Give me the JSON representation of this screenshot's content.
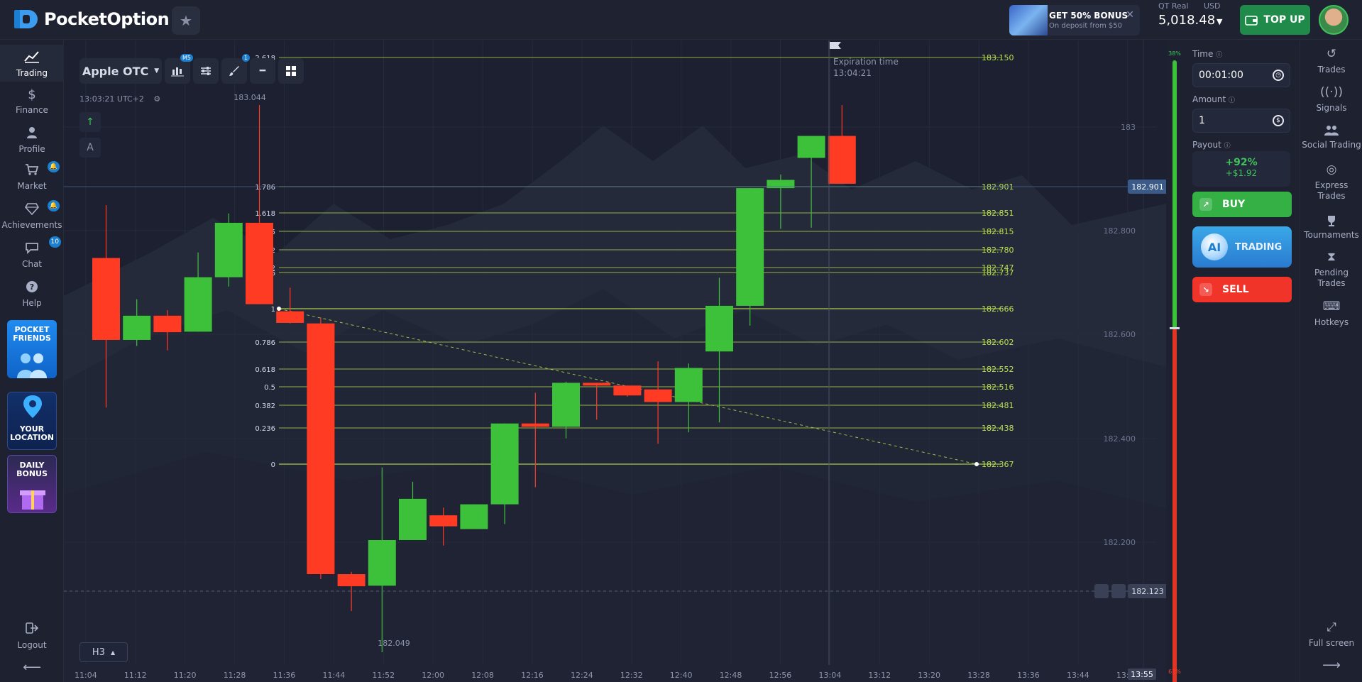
{
  "header": {
    "brand": "PocketOption",
    "bonus_title": "GET 50% BONUS",
    "bonus_sub": "On deposit from $50",
    "account_type": "QT Real",
    "currency": "USD",
    "balance": "5,018.48",
    "topup_label": "TOP UP"
  },
  "left_nav": {
    "items": [
      {
        "label": "Trading",
        "icon": "trading-chart-icon"
      },
      {
        "label": "Finance",
        "icon": "dollar-icon"
      },
      {
        "label": "Profile",
        "icon": "user-icon"
      },
      {
        "label": "Market",
        "icon": "cart-icon"
      },
      {
        "label": "Achievements",
        "icon": "diamond-icon"
      },
      {
        "label": "Chat",
        "icon": "chat-icon"
      },
      {
        "label": "Help",
        "icon": "help-icon"
      }
    ],
    "chat_badge": "10",
    "promos": {
      "friends": "POCKET FRIENDS",
      "location": "YOUR LOCATION",
      "daily": "DAILY BONUS"
    },
    "logout": "Logout"
  },
  "toolbar": {
    "asset": "Apple OTC",
    "indicator_badge": "M5",
    "drawing_badge": "1"
  },
  "chart_info": {
    "clock": "13:03:21 UTC+2",
    "timeframe": "H3",
    "expiration_label": "Expiration time",
    "expiration_time": "13:04:21",
    "high_label": "183.044",
    "low_label": "182.049"
  },
  "trade_panel": {
    "time_label": "Time",
    "time_value": "00:01:00",
    "amount_label": "Amount",
    "amount_value": "1",
    "payout_label": "Payout",
    "payout_pct": "+92%",
    "payout_amount": "+$1.92",
    "buy_label": "BUY",
    "ai_label": "TRADING",
    "ai_badge": "AI",
    "sell_label": "SELL",
    "sentiment_up": "38%",
    "sentiment_down": "62%"
  },
  "right_nav": {
    "items": [
      {
        "label": "Trades",
        "icon": "history-icon"
      },
      {
        "label": "Signals",
        "icon": "signal-icon"
      },
      {
        "label": "Social Trading",
        "icon": "people-icon"
      },
      {
        "label": "Express Trades",
        "icon": "target-icon"
      },
      {
        "label": "Tournaments",
        "icon": "trophy-icon"
      },
      {
        "label": "Pending Trades",
        "icon": "hourglass-icon"
      },
      {
        "label": "Hotkeys",
        "icon": "keyboard-icon"
      }
    ],
    "fullscreen": "Full screen"
  },
  "chart_data": {
    "type": "candlestick",
    "x": [
      "11:04",
      "11:12",
      "11:20",
      "11:28",
      "11:36",
      "11:44",
      "11:52",
      "12:00",
      "12:08",
      "12:16",
      "12:24",
      "12:32",
      "12:40",
      "12:48",
      "12:56",
      "13:04",
      "13:12",
      "13:20",
      "13:28",
      "13:36",
      "13:44",
      "13:5"
    ],
    "y_ticks": [
      "183",
      "182.800",
      "182.600",
      "182.400",
      "182.200"
    ],
    "current_price": "182.901",
    "alert_price": "182.123",
    "time_cursor": "13:55",
    "candles": [
      {
        "o": 182.766,
        "h": 182.862,
        "l": 182.494,
        "c": 182.617
      },
      {
        "o": 182.617,
        "h": 182.691,
        "l": 182.606,
        "c": 182.661
      },
      {
        "o": 182.661,
        "h": 182.671,
        "l": 182.598,
        "c": 182.631
      },
      {
        "o": 182.632,
        "h": 182.776,
        "l": 182.633,
        "c": 182.731
      },
      {
        "o": 182.731,
        "h": 182.847,
        "l": 182.714,
        "c": 182.83
      },
      {
        "o": 182.83,
        "h": 183.044,
        "l": 182.689,
        "c": 182.682
      },
      {
        "o": 182.669,
        "h": 182.712,
        "l": 182.647,
        "c": 182.648
      },
      {
        "o": 182.647,
        "h": 182.658,
        "l": 182.182,
        "c": 182.191
      },
      {
        "o": 182.191,
        "h": 182.195,
        "l": 182.124,
        "c": 182.169
      },
      {
        "o": 182.17,
        "h": 182.385,
        "l": 182.049,
        "c": 182.253
      },
      {
        "o": 182.253,
        "h": 182.359,
        "l": 182.315,
        "c": 182.328
      },
      {
        "o": 182.298,
        "h": 182.312,
        "l": 182.243,
        "c": 182.278
      },
      {
        "o": 182.273,
        "h": 182.297,
        "l": 182.289,
        "c": 182.318
      },
      {
        "o": 182.318,
        "h": 182.439,
        "l": 182.282,
        "c": 182.465
      },
      {
        "o": 182.465,
        "h": 182.521,
        "l": 182.349,
        "c": 182.459
      },
      {
        "o": 182.459,
        "h": 182.541,
        "l": 182.438,
        "c": 182.539
      },
      {
        "o": 182.539,
        "h": 182.536,
        "l": 182.472,
        "c": 182.534
      },
      {
        "o": 182.534,
        "h": 182.504,
        "l": 182.514,
        "c": 182.516
      },
      {
        "o": 182.527,
        "h": 182.578,
        "l": 182.428,
        "c": 182.504
      },
      {
        "o": 182.504,
        "h": 182.574,
        "l": 182.449,
        "c": 182.566
      },
      {
        "o": 182.596,
        "h": 182.73,
        "l": 182.467,
        "c": 182.679
      },
      {
        "o": 182.679,
        "h": 182.86,
        "l": 182.643,
        "c": 182.893
      },
      {
        "o": 182.893,
        "h": 182.918,
        "l": 182.819,
        "c": 182.908
      },
      {
        "o": 182.948,
        "h": 182.956,
        "l": 182.821,
        "c": 182.988
      },
      {
        "o": 182.988,
        "h": 183.044,
        "l": 182.901,
        "c": 182.901
      }
    ],
    "fib_levels": [
      {
        "ratio": "2.618",
        "price": "183.150"
      },
      {
        "ratio": "1.786",
        "price": "182.901"
      },
      {
        "ratio": "1.618",
        "price": "182.851"
      },
      {
        "ratio": "1.5",
        "price": "182.815"
      },
      {
        "ratio": "1.382",
        "price": "182.780"
      },
      {
        "ratio": "1.272",
        "price": "182.747"
      },
      {
        "ratio": "1.236",
        "price": "182.737"
      },
      {
        "ratio": "1",
        "price": "182.666"
      },
      {
        "ratio": "0.786",
        "price": "182.602"
      },
      {
        "ratio": "0.618",
        "price": "182.552"
      },
      {
        "ratio": "0.5",
        "price": "182.516"
      },
      {
        "ratio": "0.382",
        "price": "182.481"
      },
      {
        "ratio": "0.236",
        "price": "182.438"
      },
      {
        "ratio": "0",
        "price": "182.367"
      }
    ],
    "colors": {
      "up": "#3ec13a",
      "down": "#ff3b24",
      "fib": "#b8e04a"
    }
  }
}
